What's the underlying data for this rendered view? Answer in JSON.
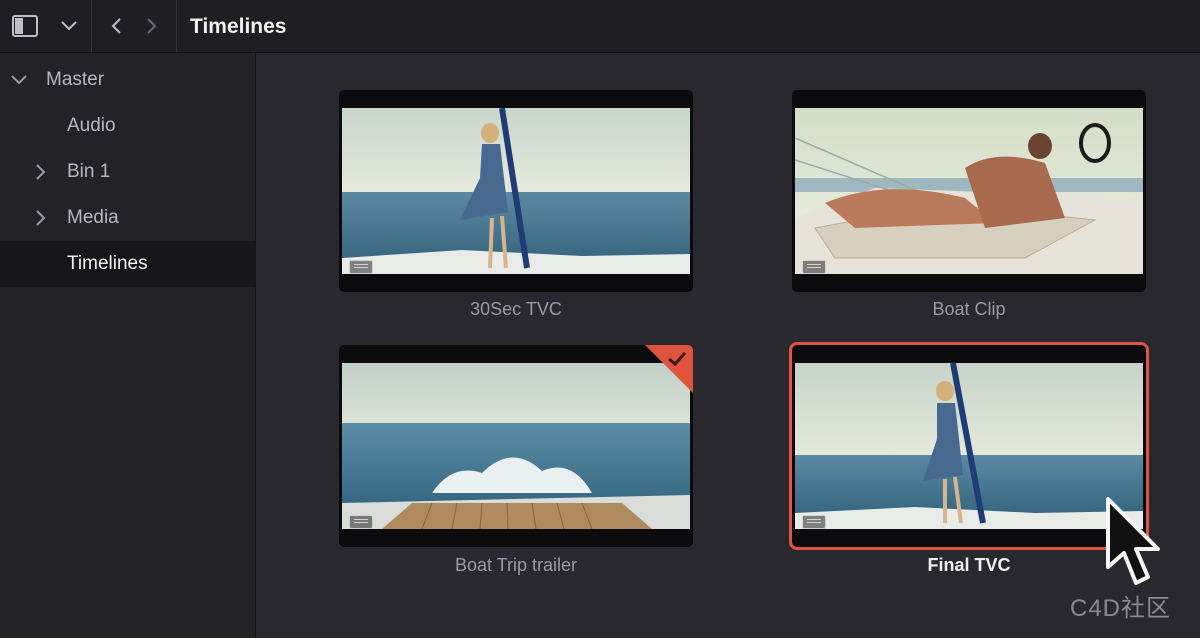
{
  "toolbar": {
    "title": "Timelines",
    "icons": [
      "sidebar-toggle-icon",
      "chevron-down-icon",
      "back-icon",
      "forward-icon"
    ]
  },
  "sidebar": {
    "root": {
      "label": "Master",
      "expanded": true
    },
    "items": [
      {
        "label": "Audio",
        "has_children": false,
        "selected": false
      },
      {
        "label": "Bin 1",
        "has_children": true,
        "selected": false
      },
      {
        "label": "Media",
        "has_children": true,
        "selected": false
      },
      {
        "label": "Timelines",
        "has_children": false,
        "selected": true
      }
    ]
  },
  "clips": [
    {
      "name": "30Sec TVC",
      "selected": false,
      "flagged": false
    },
    {
      "name": "Boat Clip",
      "selected": false,
      "flagged": false
    },
    {
      "name": "Boat Trip trailer",
      "selected": false,
      "flagged": true
    },
    {
      "name": "Final TVC",
      "selected": true,
      "flagged": false
    }
  ],
  "colors": {
    "accent": "#e0533f",
    "background": "#28282e",
    "sidebar": "#222227",
    "toolbar": "#1e1e23"
  },
  "watermark": "C4D社区"
}
